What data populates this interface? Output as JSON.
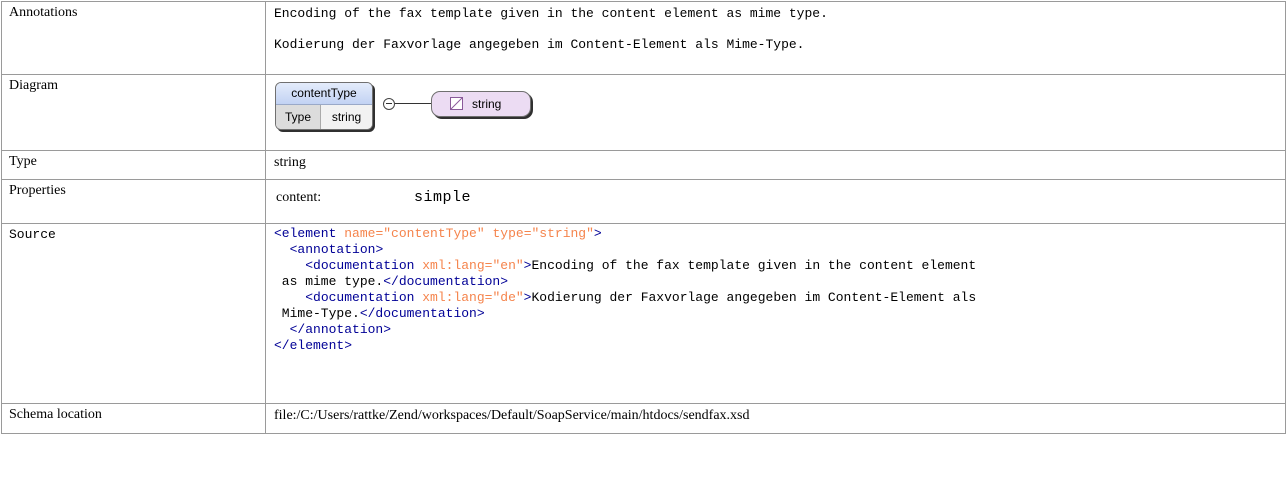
{
  "rows": {
    "annotations": {
      "label": "Annotations",
      "line1": "Encoding of the fax template given in the content element as mime type.",
      "line2": "Kodierung der Faxvorlage angegeben im Content-Element als Mime-Type."
    },
    "diagram": {
      "label": "Diagram",
      "element_name": "contentType",
      "type_key": "Type",
      "type_value": "string",
      "simple_type": "string",
      "icons": {
        "collapse": "minus-circle-icon",
        "simple_type": "simple-type-icon"
      }
    },
    "type": {
      "label": "Type",
      "value": "string"
    },
    "properties": {
      "label": "Properties",
      "key": "content:",
      "value": "simple"
    },
    "source": {
      "label": "Source",
      "lines": [
        "<element name=\"contentType\" type=\"string\">",
        "  <annotation>",
        "    <documentation xml:lang=\"en\">Encoding of the fax template given in the content element",
        " as mime type.</documentation>",
        "    <documentation xml:lang=\"de\">Kodierung der Faxvorlage angegeben im Content-Element als",
        " Mime-Type.</documentation>",
        "  </annotation>",
        "</element>"
      ]
    },
    "schema_location": {
      "label": "Schema location",
      "value": "file:/C:/Users/rattke/Zend/workspaces/Default/SoapService/main/htdocs/sendfax.xsd"
    }
  },
  "colors": {
    "tag": "#000096",
    "attr_name": "#f5844c",
    "attr_value": "#993300",
    "border": "#9a9a9a"
  }
}
